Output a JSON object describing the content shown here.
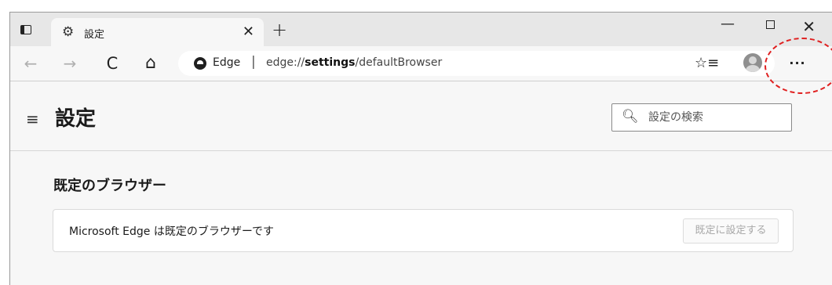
{
  "tab": {
    "title": "設定"
  },
  "toolbar": {
    "back_icon": "←",
    "forward_icon": "→",
    "refresh_icon": "C",
    "home_icon": "⌂",
    "more_icon": "···"
  },
  "address_bar": {
    "site_label": "Edge",
    "separator": "|",
    "url_prefix": "edge://",
    "url_bold": "settings",
    "url_suffix": "/defaultBrowser"
  },
  "settings": {
    "page_title": "設定",
    "search_placeholder": "設定の検索",
    "section_title": "既定のブラウザー",
    "status_message": "Microsoft Edge は既定のブラウザーです",
    "set_default_button": "既定に設定する"
  },
  "colors": {
    "annotation": "#e02020",
    "window_bg": "#f7f7f7",
    "tabstrip_bg": "#e7e7e7"
  }
}
